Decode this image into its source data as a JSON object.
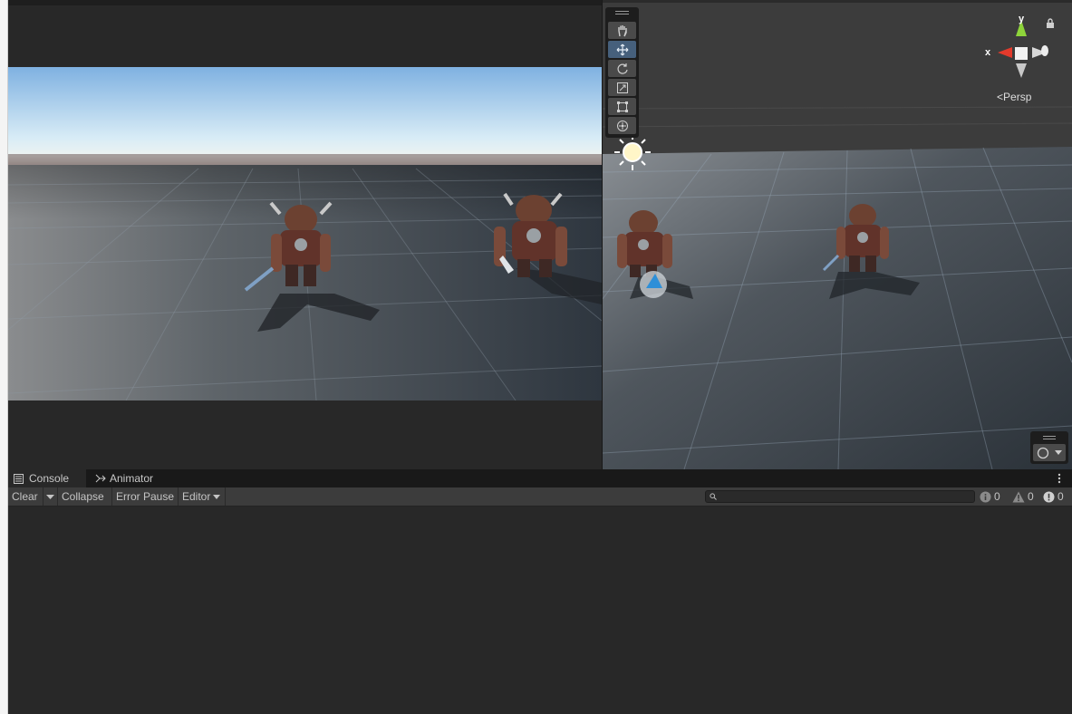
{
  "scene": {
    "projection_label": "Persp",
    "gizmo_axes": {
      "x": "x",
      "y": "y"
    },
    "tools": [
      {
        "name": "hand-tool",
        "active": false
      },
      {
        "name": "move-tool",
        "active": true
      },
      {
        "name": "rotate-tool",
        "active": false
      },
      {
        "name": "scale-tool",
        "active": false
      },
      {
        "name": "rect-tool",
        "active": false
      },
      {
        "name": "transform-tool",
        "active": false
      }
    ]
  },
  "console": {
    "tabs": [
      {
        "label": "Console",
        "icon": "console-icon"
      },
      {
        "label": "Animator",
        "icon": "animator-icon"
      }
    ],
    "toolbar": {
      "clear_label": "Clear",
      "collapse_label": "Collapse",
      "error_pause_label": "Error Pause",
      "editor_label": "Editor"
    },
    "counts": {
      "logs": "0",
      "warnings": "0",
      "errors": "0"
    }
  },
  "colors": {
    "panel_bg": "#282828",
    "scene_bg": "#3b3b3b",
    "tool_active": "#46607c",
    "gizmo_x": "#e33a2c",
    "gizmo_y": "#8ed43a"
  }
}
